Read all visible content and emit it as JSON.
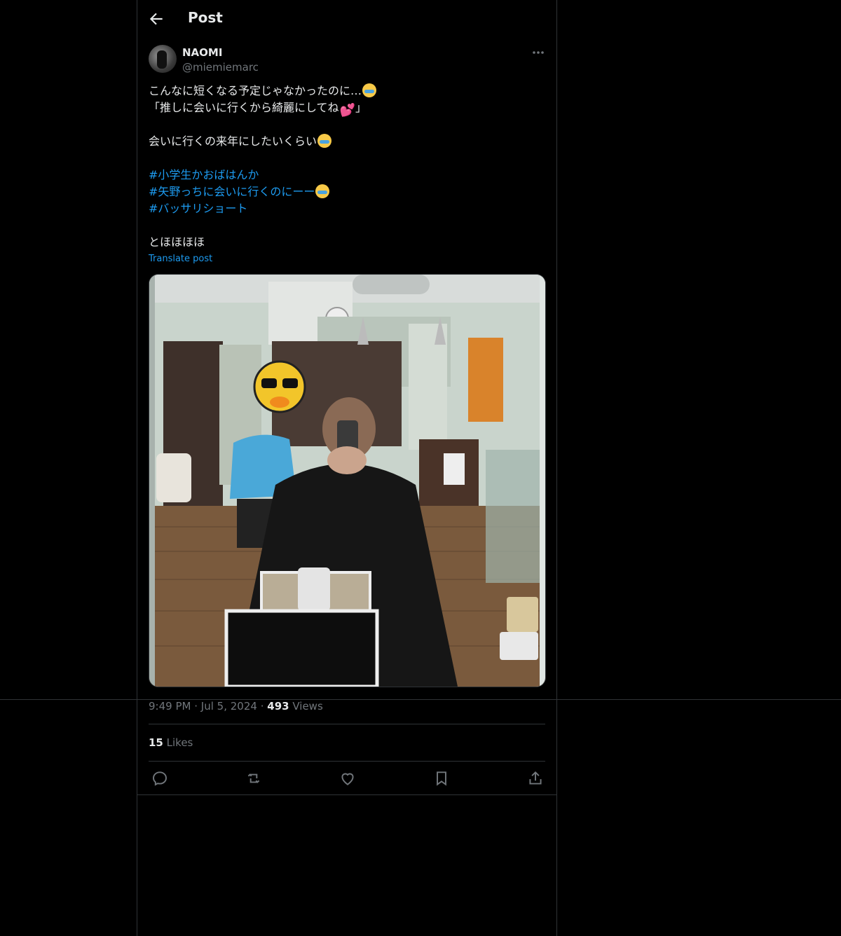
{
  "header": {
    "title": "Post"
  },
  "author": {
    "name": "NAOMI",
    "handle": "@miemiemarc"
  },
  "post": {
    "line1": "こんなに短くなる予定じゃなかったのに…",
    "line2a": "「推しに会いに行くから綺麗にしてね",
    "line2b": "」",
    "line3": "会いに行くの来年にしたいくらい",
    "hashtag1": "#小学生かおばはんか",
    "hashtag2": "#矢野っちに会いに行くのにーー",
    "hashtag3": "#バッサリショート",
    "line4": "とほほほほ",
    "translate_label": "Translate post"
  },
  "meta": {
    "time": "9:49 PM",
    "dot1": "·",
    "date": "Jul 5, 2024",
    "dot2": "·",
    "views_count": "493",
    "views_label": "Views"
  },
  "likes": {
    "count": "15",
    "label": "Likes"
  },
  "actions": [
    "reply-icon",
    "repost-icon",
    "like-icon",
    "bookmark-icon",
    "share-icon"
  ],
  "colors": {
    "background": "#000000",
    "text": "#e7e9ea",
    "muted": "#71767b",
    "link": "#1d9bf0",
    "border": "#2f3336"
  }
}
